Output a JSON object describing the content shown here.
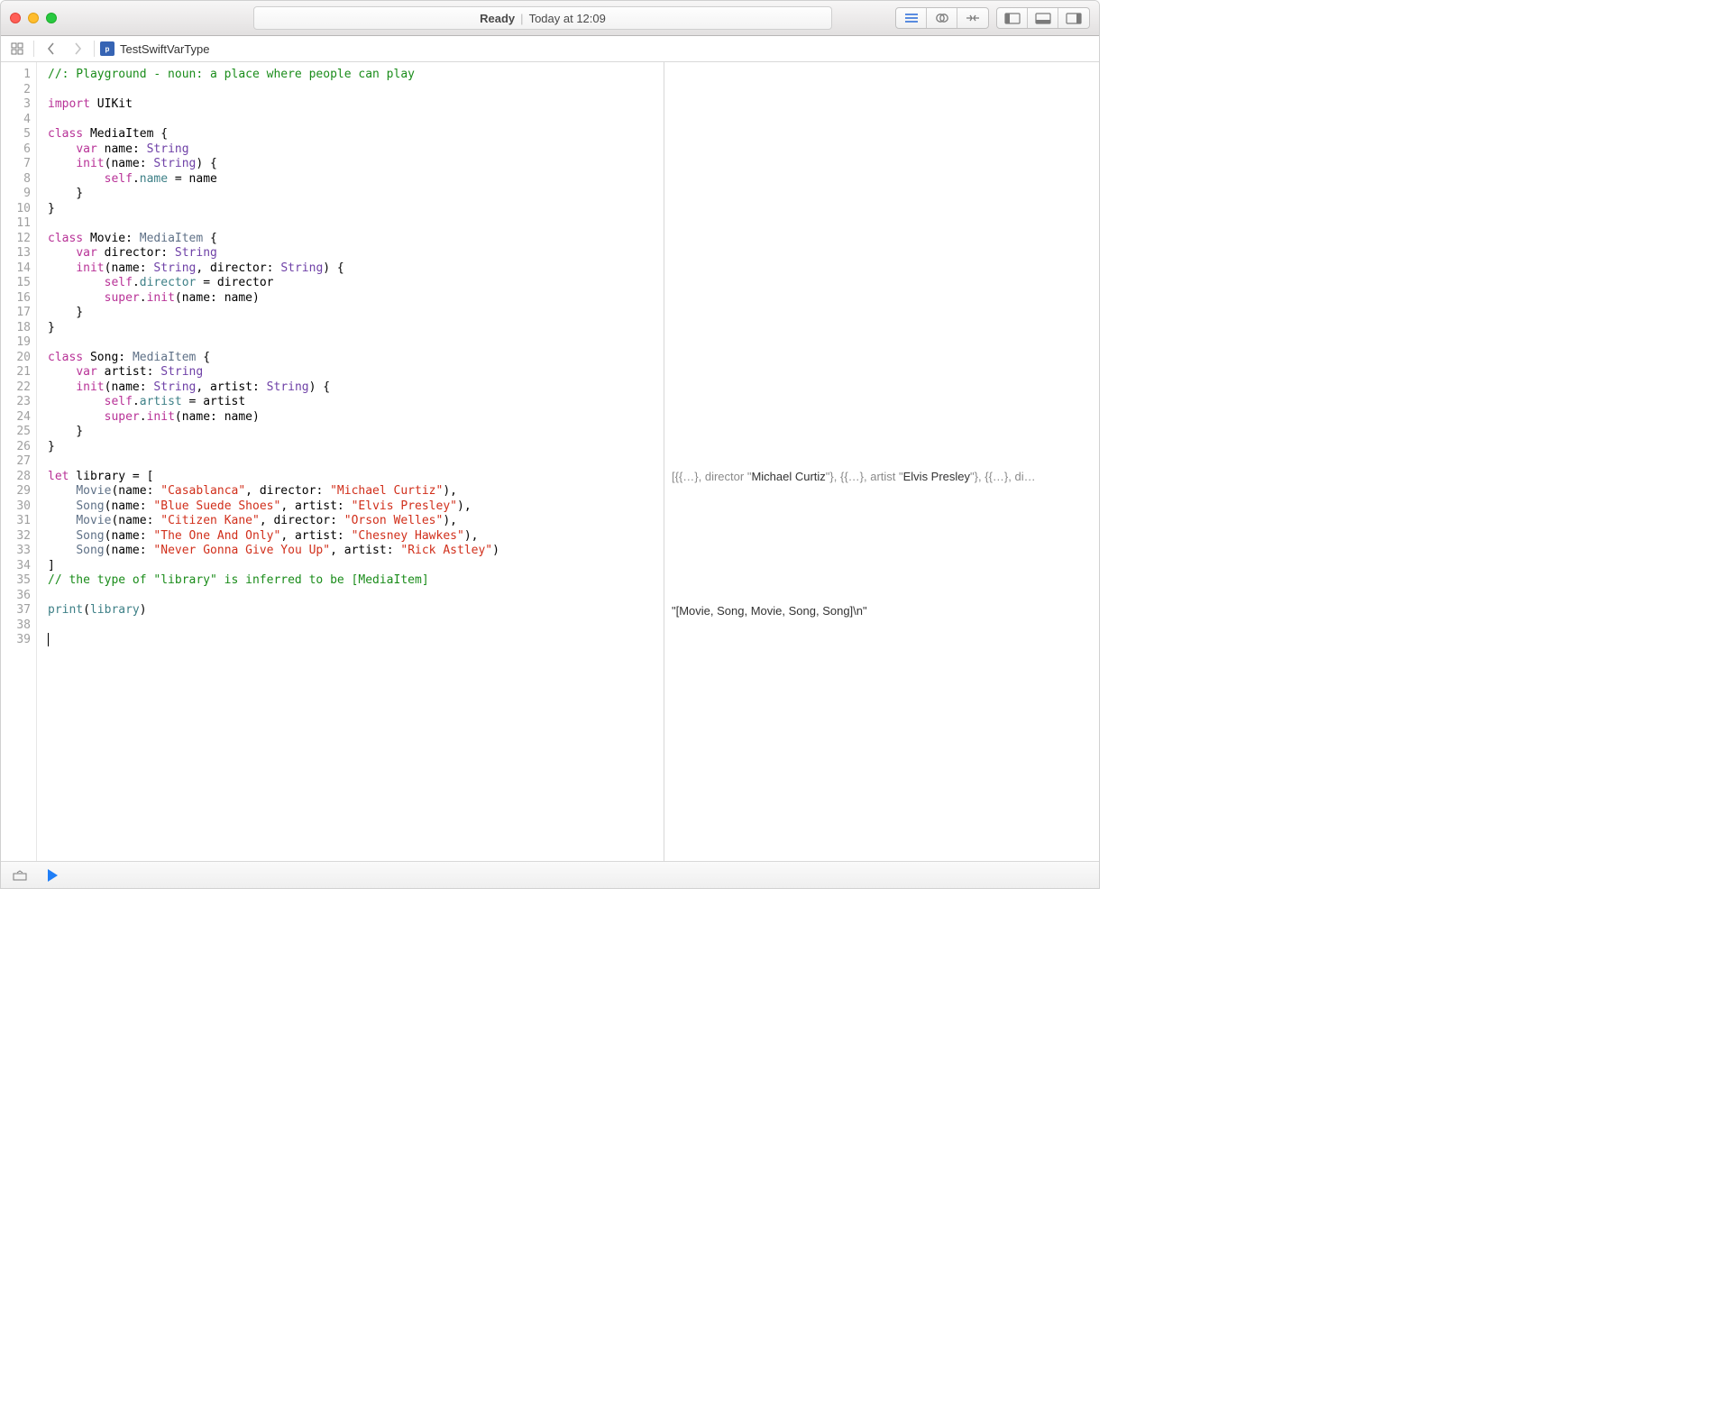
{
  "titlebar": {
    "status_label": "Ready",
    "status_time": "Today at 12:09"
  },
  "nav": {
    "breadcrumb": "TestSwiftVarType"
  },
  "code": {
    "line_count": 39,
    "lines": [
      {
        "t": "cmt",
        "s": "//: Playground - noun: a place where people can play"
      },
      {
        "t": "blank",
        "s": ""
      },
      {
        "t": "import",
        "s": "import UIKit"
      },
      {
        "t": "blank",
        "s": ""
      },
      {
        "t": "classdecl",
        "s": "class MediaItem {"
      },
      {
        "t": "vardecl",
        "s": "    var name: String"
      },
      {
        "t": "initdecl",
        "s": "    init(name: String) {"
      },
      {
        "t": "assign",
        "s": "        self.name = name"
      },
      {
        "t": "plain",
        "s": "    }"
      },
      {
        "t": "plain",
        "s": "}"
      },
      {
        "t": "blank",
        "s": ""
      },
      {
        "t": "classdecl_ext",
        "s": "class Movie: MediaItem {",
        "cls": "Movie",
        "base": "MediaItem"
      },
      {
        "t": "vardecl",
        "s": "    var director: String"
      },
      {
        "t": "initdecl2",
        "s": "    init(name: String, director: String) {"
      },
      {
        "t": "assign2",
        "s": "        self.director = director"
      },
      {
        "t": "superinit",
        "s": "        super.init(name: name)"
      },
      {
        "t": "plain",
        "s": "    }"
      },
      {
        "t": "plain",
        "s": "}"
      },
      {
        "t": "blank",
        "s": ""
      },
      {
        "t": "classdecl_ext",
        "s": "class Song: MediaItem {",
        "cls": "Song",
        "base": "MediaItem"
      },
      {
        "t": "vardecl",
        "s": "    var artist: String"
      },
      {
        "t": "initdecl2b",
        "s": "    init(name: String, artist: String) {"
      },
      {
        "t": "assign3",
        "s": "        self.artist = artist"
      },
      {
        "t": "superinit",
        "s": "        super.init(name: name)"
      },
      {
        "t": "plain",
        "s": "    }"
      },
      {
        "t": "plain",
        "s": "}"
      },
      {
        "t": "blank",
        "s": ""
      },
      {
        "t": "let",
        "s": "let library = ["
      },
      {
        "t": "call",
        "s": "    Movie(name: \"Casablanca\", director: \"Michael Curtiz\"),",
        "cls": "Movie",
        "args": [
          [
            "name",
            "\"Casablanca\""
          ],
          [
            "director",
            "\"Michael Curtiz\""
          ]
        ]
      },
      {
        "t": "call",
        "s": "    Song(name: \"Blue Suede Shoes\", artist: \"Elvis Presley\"),",
        "cls": "Song",
        "args": [
          [
            "name",
            "\"Blue Suede Shoes\""
          ],
          [
            "artist",
            "\"Elvis Presley\""
          ]
        ]
      },
      {
        "t": "call",
        "s": "    Movie(name: \"Citizen Kane\", director: \"Orson Welles\"),",
        "cls": "Movie",
        "args": [
          [
            "name",
            "\"Citizen Kane\""
          ],
          [
            "director",
            "\"Orson Welles\""
          ]
        ]
      },
      {
        "t": "call",
        "s": "    Song(name: \"The One And Only\", artist: \"Chesney Hawkes\"),",
        "cls": "Song",
        "args": [
          [
            "name",
            "\"The One And Only\""
          ],
          [
            "artist",
            "\"Chesney Hawkes\""
          ]
        ]
      },
      {
        "t": "call",
        "s": "    Song(name: \"Never Gonna Give You Up\", artist: \"Rick Astley\")",
        "cls": "Song",
        "args": [
          [
            "name",
            "\"Never Gonna Give You Up\""
          ],
          [
            "artist",
            "\"Rick Astley\""
          ]
        ]
      },
      {
        "t": "plain",
        "s": "]"
      },
      {
        "t": "cmt",
        "s": "// the type of \"library\" is inferred to be [MediaItem]"
      },
      {
        "t": "blank",
        "s": ""
      },
      {
        "t": "print",
        "s": "print(library)"
      },
      {
        "t": "blank",
        "s": ""
      },
      {
        "t": "cursor",
        "s": ""
      }
    ]
  },
  "results": {
    "line28_pre": "[{{…}, director \"",
    "line28_b1": "Michael Curtiz",
    "line28_mid": "\"}, {{…}, artist \"",
    "line28_b2": "Elvis Presley",
    "line28_post": "\"}, {{…}, di…",
    "line37": "\"[Movie, Song, Movie, Song, Song]\\n\""
  }
}
